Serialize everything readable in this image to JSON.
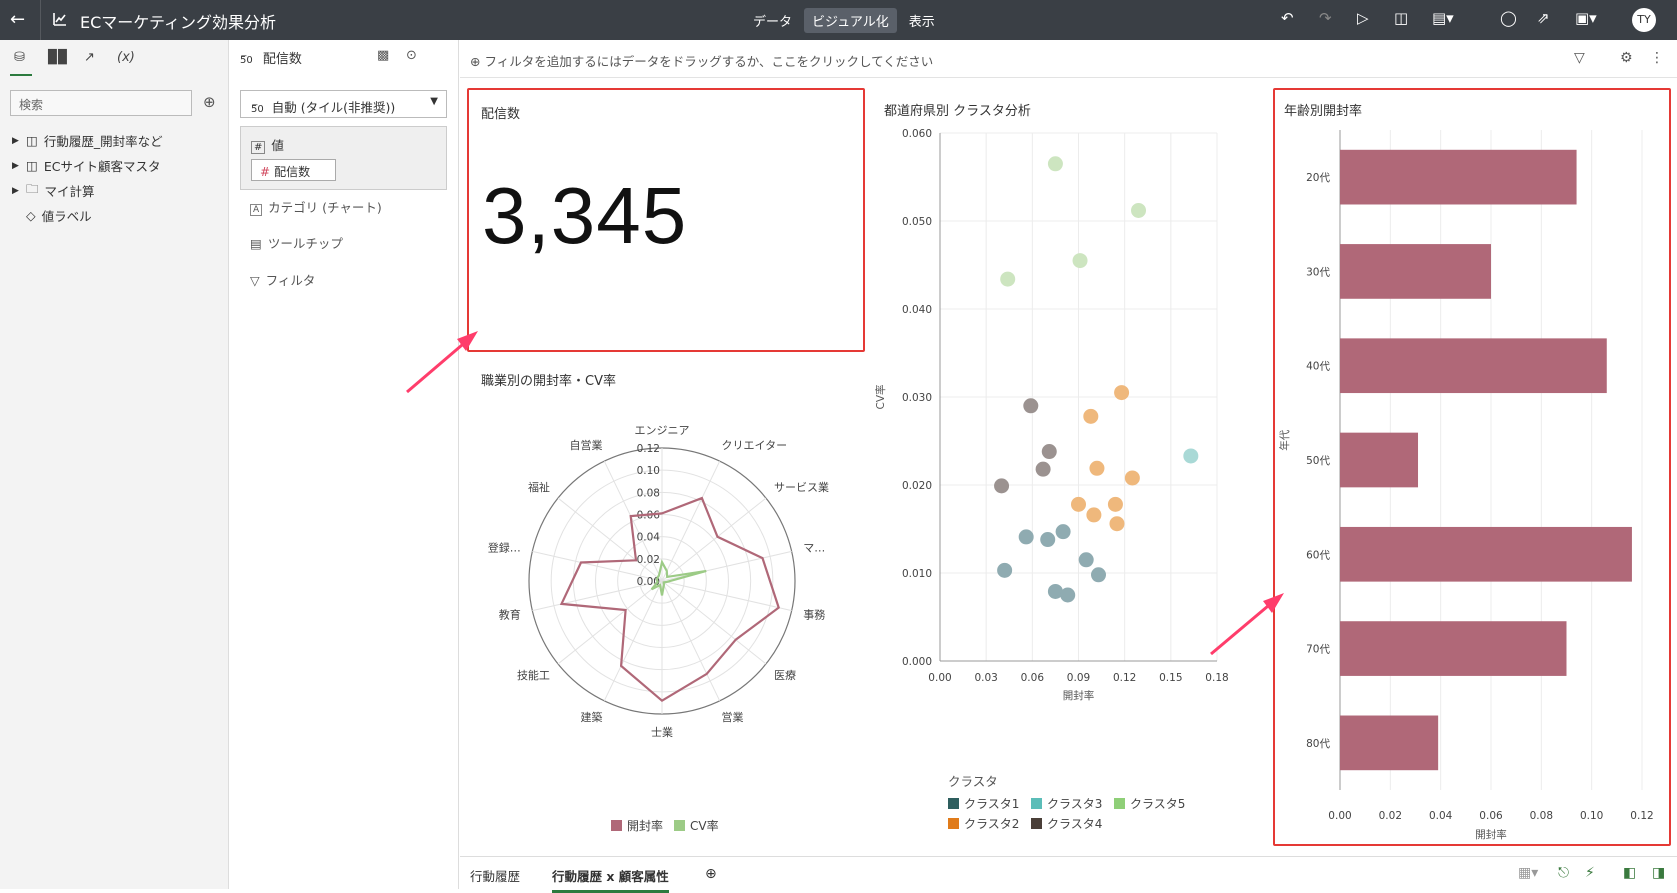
{
  "topbar": {
    "title": "ECマーケティング効果分析",
    "modes": [
      "データ",
      "ビジュアル化",
      "表示"
    ],
    "active_mode": "ビジュアル化",
    "avatar": "TY"
  },
  "left_panel": {
    "search_placeholder": "検索",
    "tree": [
      {
        "label": "行動履歴_開封率など",
        "icon": "dataset-icon",
        "expandable": true
      },
      {
        "label": "ECサイト顧客マスタ",
        "icon": "dataset-icon",
        "expandable": true
      },
      {
        "label": "マイ計算",
        "icon": "folder-icon",
        "expandable": true
      },
      {
        "label": "値ラベル",
        "icon": "tag-icon",
        "expandable": false
      }
    ]
  },
  "field_panel": {
    "header": "配信数",
    "viz_type": "自動 (タイル(非推奨))",
    "value_label": "値",
    "value_chip": "配信数",
    "rows": [
      "カテゴリ (チャート)",
      "ツールチップ",
      "フィルタ"
    ]
  },
  "filter_bar": {
    "placeholder": "フィルタを追加するにはデータをドラッグするか、ここをクリックしてください"
  },
  "kpi": {
    "title": "配信数",
    "value": "3,345"
  },
  "radar": {
    "title": "職業別の開封率・CV率",
    "legend": [
      "開封率",
      "CV率"
    ]
  },
  "scatter": {
    "title": "都道府県別 クラスタ分析",
    "legend_title": "クラスタ",
    "legend": [
      "クラスタ1",
      "クラスタ3",
      "クラスタ5",
      "クラスタ2",
      "クラスタ4"
    ]
  },
  "bar": {
    "title": "年齢別開封率"
  },
  "bottom_tabs": [
    "行動履歴",
    "行動履歴 x 顧客属性"
  ],
  "active_tab": "行動履歴 x 顧客属性",
  "colors": {
    "open_rate": "#b06878",
    "cv_rate": "#9ccb86",
    "cluster1": "#8fabb1",
    "cluster2": "#efb87c",
    "cluster3": "#a9d9d6",
    "cluster4": "#9b9290",
    "cluster5": "#cde5c0",
    "highlight": "#e53935",
    "legend1": "#2e5e5e",
    "legend2": "#e07b1a",
    "legend3": "#5bbdb8",
    "legend4": "#4a3f38",
    "legend5": "#8fcf78"
  },
  "chart_data": [
    {
      "type": "radar",
      "title": "職業別の開封率・CV率",
      "categories": [
        "エンジニア",
        "クリエイター",
        "サービス業",
        "マ…",
        "事務",
        "医療",
        "営業",
        "士業",
        "建築",
        "技能工",
        "教育",
        "登録…",
        "福祉",
        "自営業"
      ],
      "rlim": [
        0,
        0.12
      ],
      "ticks": [
        0.0,
        0.02,
        0.04,
        0.06,
        0.08,
        0.1,
        0.12
      ],
      "tick_labels": [
        "0.00",
        "0.02",
        "0.04",
        "0.06",
        "0.08",
        "0.10",
        "0.12"
      ],
      "series": [
        {
          "name": "開封率",
          "values": [
            0.061,
            0.083,
            0.064,
            0.093,
            0.108,
            0.085,
            0.093,
            0.108,
            0.085,
            0.042,
            0.093,
            0.075,
            0.03,
            0.065
          ]
        },
        {
          "name": "CV率",
          "values": [
            0.017,
            0.01,
            0.006,
            0.041,
            0.004,
            0.002,
            0.004,
            0.013,
            0.004,
            0.012,
            0.004,
            0.005,
            0.005,
            0.006
          ]
        }
      ]
    },
    {
      "type": "scatter",
      "title": "都道府県別 クラスタ分析",
      "xlabel": "開封率",
      "ylabel": "CV率",
      "xlim": [
        0,
        0.18
      ],
      "ylim": [
        0,
        0.06
      ],
      "x_ticks": [
        "0.00",
        "0.03",
        "0.06",
        "0.09",
        "0.12",
        "0.15",
        "0.18"
      ],
      "y_ticks": [
        "0.000",
        "0.010",
        "0.020",
        "0.030",
        "0.040",
        "0.050",
        "0.060"
      ],
      "series": [
        {
          "name": "クラスタ1",
          "points": [
            [
              0.042,
              0.0103
            ],
            [
              0.056,
              0.0141
            ],
            [
              0.07,
              0.0138
            ],
            [
              0.08,
              0.0147
            ],
            [
              0.075,
              0.0079
            ],
            [
              0.095,
              0.0115
            ],
            [
              0.083,
              0.0075
            ],
            [
              0.103,
              0.0098
            ]
          ]
        },
        {
          "name": "クラスタ2",
          "points": [
            [
              0.098,
              0.0278
            ],
            [
              0.118,
              0.0305
            ],
            [
              0.102,
              0.0219
            ],
            [
              0.125,
              0.0208
            ],
            [
              0.09,
              0.0178
            ],
            [
              0.114,
              0.0178
            ],
            [
              0.1,
              0.0166
            ],
            [
              0.115,
              0.0156
            ]
          ]
        },
        {
          "name": "クラスタ3",
          "points": [
            [
              0.163,
              0.0233
            ]
          ]
        },
        {
          "name": "クラスタ4",
          "points": [
            [
              0.059,
              0.029
            ],
            [
              0.071,
              0.0238
            ],
            [
              0.067,
              0.0218
            ],
            [
              0.04,
              0.0199
            ]
          ]
        },
        {
          "name": "クラスタ5",
          "points": [
            [
              0.075,
              0.0565
            ],
            [
              0.129,
              0.0512
            ],
            [
              0.091,
              0.0455
            ],
            [
              0.044,
              0.0434
            ]
          ]
        }
      ]
    },
    {
      "type": "bar",
      "orientation": "horizontal",
      "title": "年齢別開封率",
      "xlabel": "開封率",
      "ylabel": "年代",
      "categories": [
        "20代",
        "30代",
        "40代",
        "50代",
        "60代",
        "70代",
        "80代"
      ],
      "values": [
        0.094,
        0.06,
        0.106,
        0.031,
        0.116,
        0.09,
        0.039
      ],
      "xlim": [
        0,
        0.12
      ],
      "x_ticks": [
        "0.00",
        "0.02",
        "0.04",
        "0.06",
        "0.08",
        "0.10",
        "0.12"
      ]
    }
  ]
}
